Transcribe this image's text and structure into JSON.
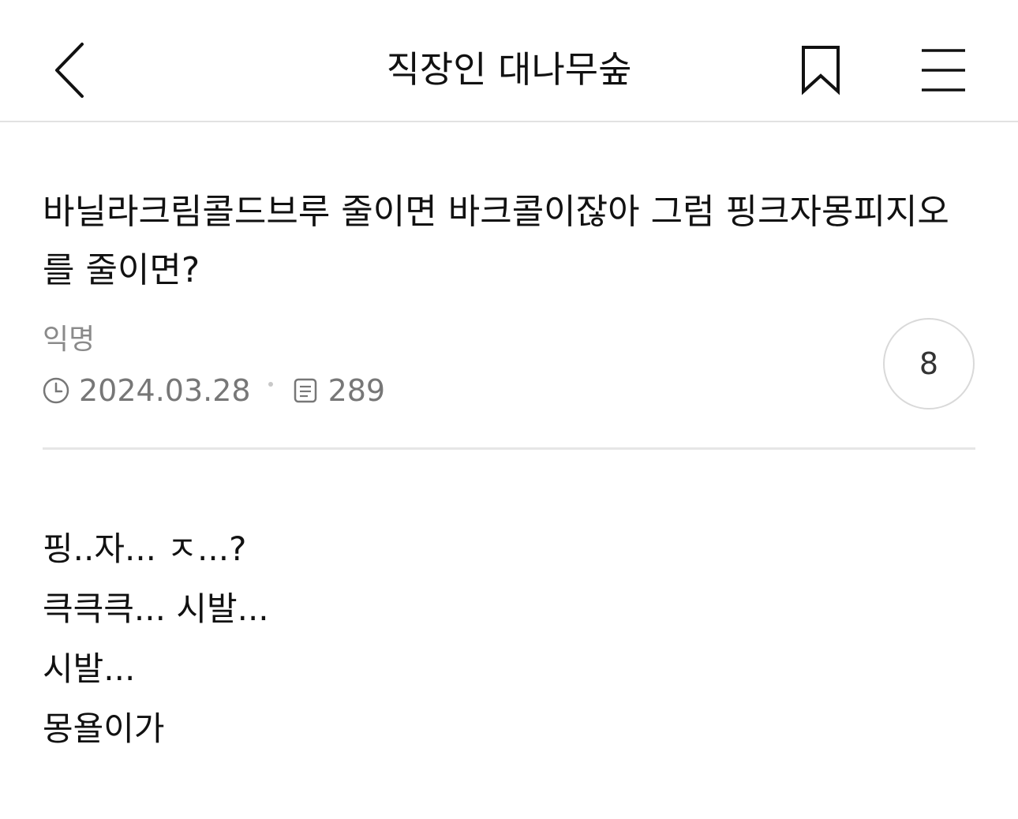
{
  "header": {
    "title": "직장인 대나무숲",
    "back_icon": "back-chevron-icon",
    "bookmark_icon": "bookmark-icon",
    "menu_icon": "hamburger-menu-icon"
  },
  "post": {
    "title": "바닐라크림콜드브루 줄이면 바크콜이잖아 그럼 핑크자몽피지오를 줄이면?",
    "author": "익명",
    "date": "2024.03.28",
    "views": "289",
    "comment_count": "8",
    "body_lines": [
      "핑..자... ㅈ...?",
      "큭큭큭... 시발...",
      "시발...",
      "몽욜이가"
    ]
  },
  "colors": {
    "text": "#111111",
    "meta": "#777777",
    "divider": "#e6e6e6"
  }
}
